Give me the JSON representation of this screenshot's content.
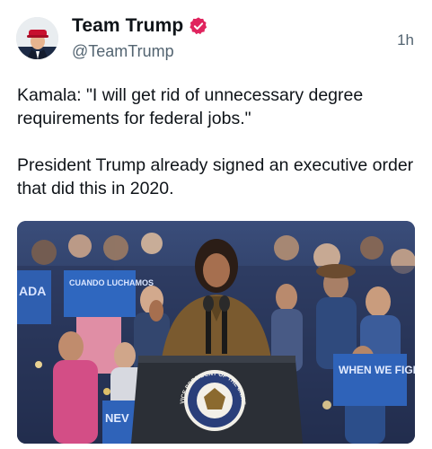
{
  "post": {
    "display_name": "Team Trump",
    "handle": "@TeamTrump",
    "timestamp": "1h",
    "text_paragraphs": [
      "Kamala: \"I will get rid of unnecessary degree requirements for federal jobs.\"",
      "President Trump already signed an executive order that did this in 2020."
    ],
    "verified_color": "#e0245e"
  },
  "media": {
    "signs": [
      "ADA",
      "CUANDO LUCHAMOS",
      "WHEN WE FIGHT,",
      "NEV"
    ],
    "seal_text": "VICE PRESIDENT OF THE UNITED STATES"
  },
  "icons": {
    "verified": "verified-badge-icon"
  }
}
